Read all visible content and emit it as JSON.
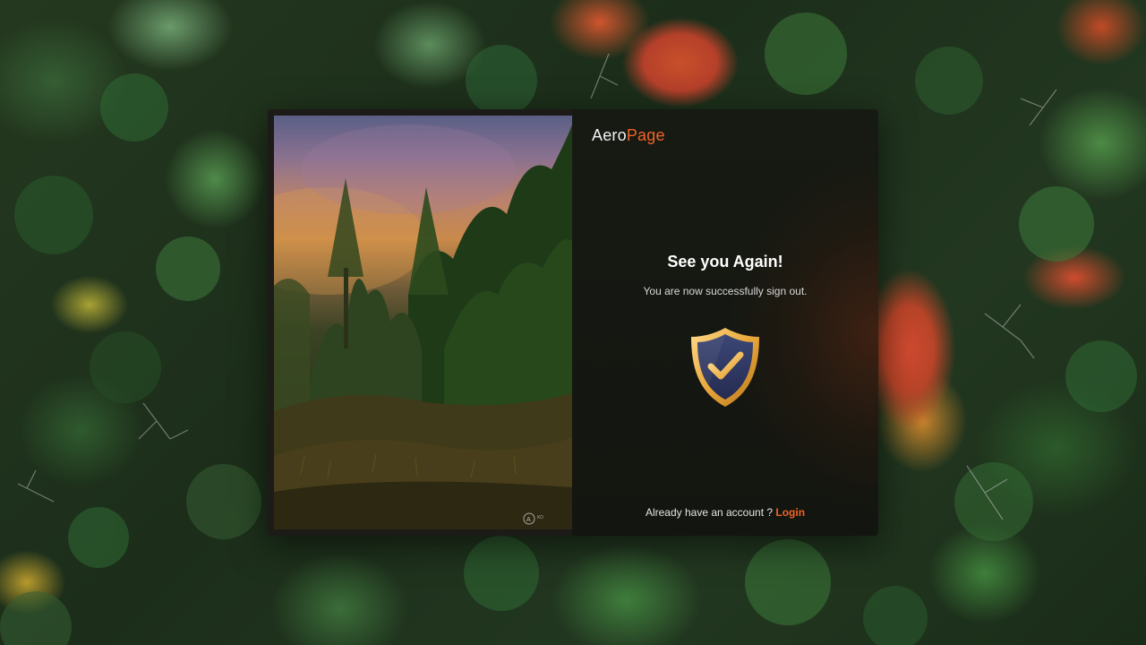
{
  "brand": {
    "name_part1": "Aero",
    "name_part2": "Page",
    "accent_color": "#f06425"
  },
  "signout": {
    "title": "See you Again!",
    "message": "You are now successfully sign out.",
    "icon": "shield-check-icon"
  },
  "footer": {
    "prompt": "Already have an account ? ",
    "login_label": "Login"
  },
  "photo": {
    "description_icon": "forest-sunset-image"
  }
}
